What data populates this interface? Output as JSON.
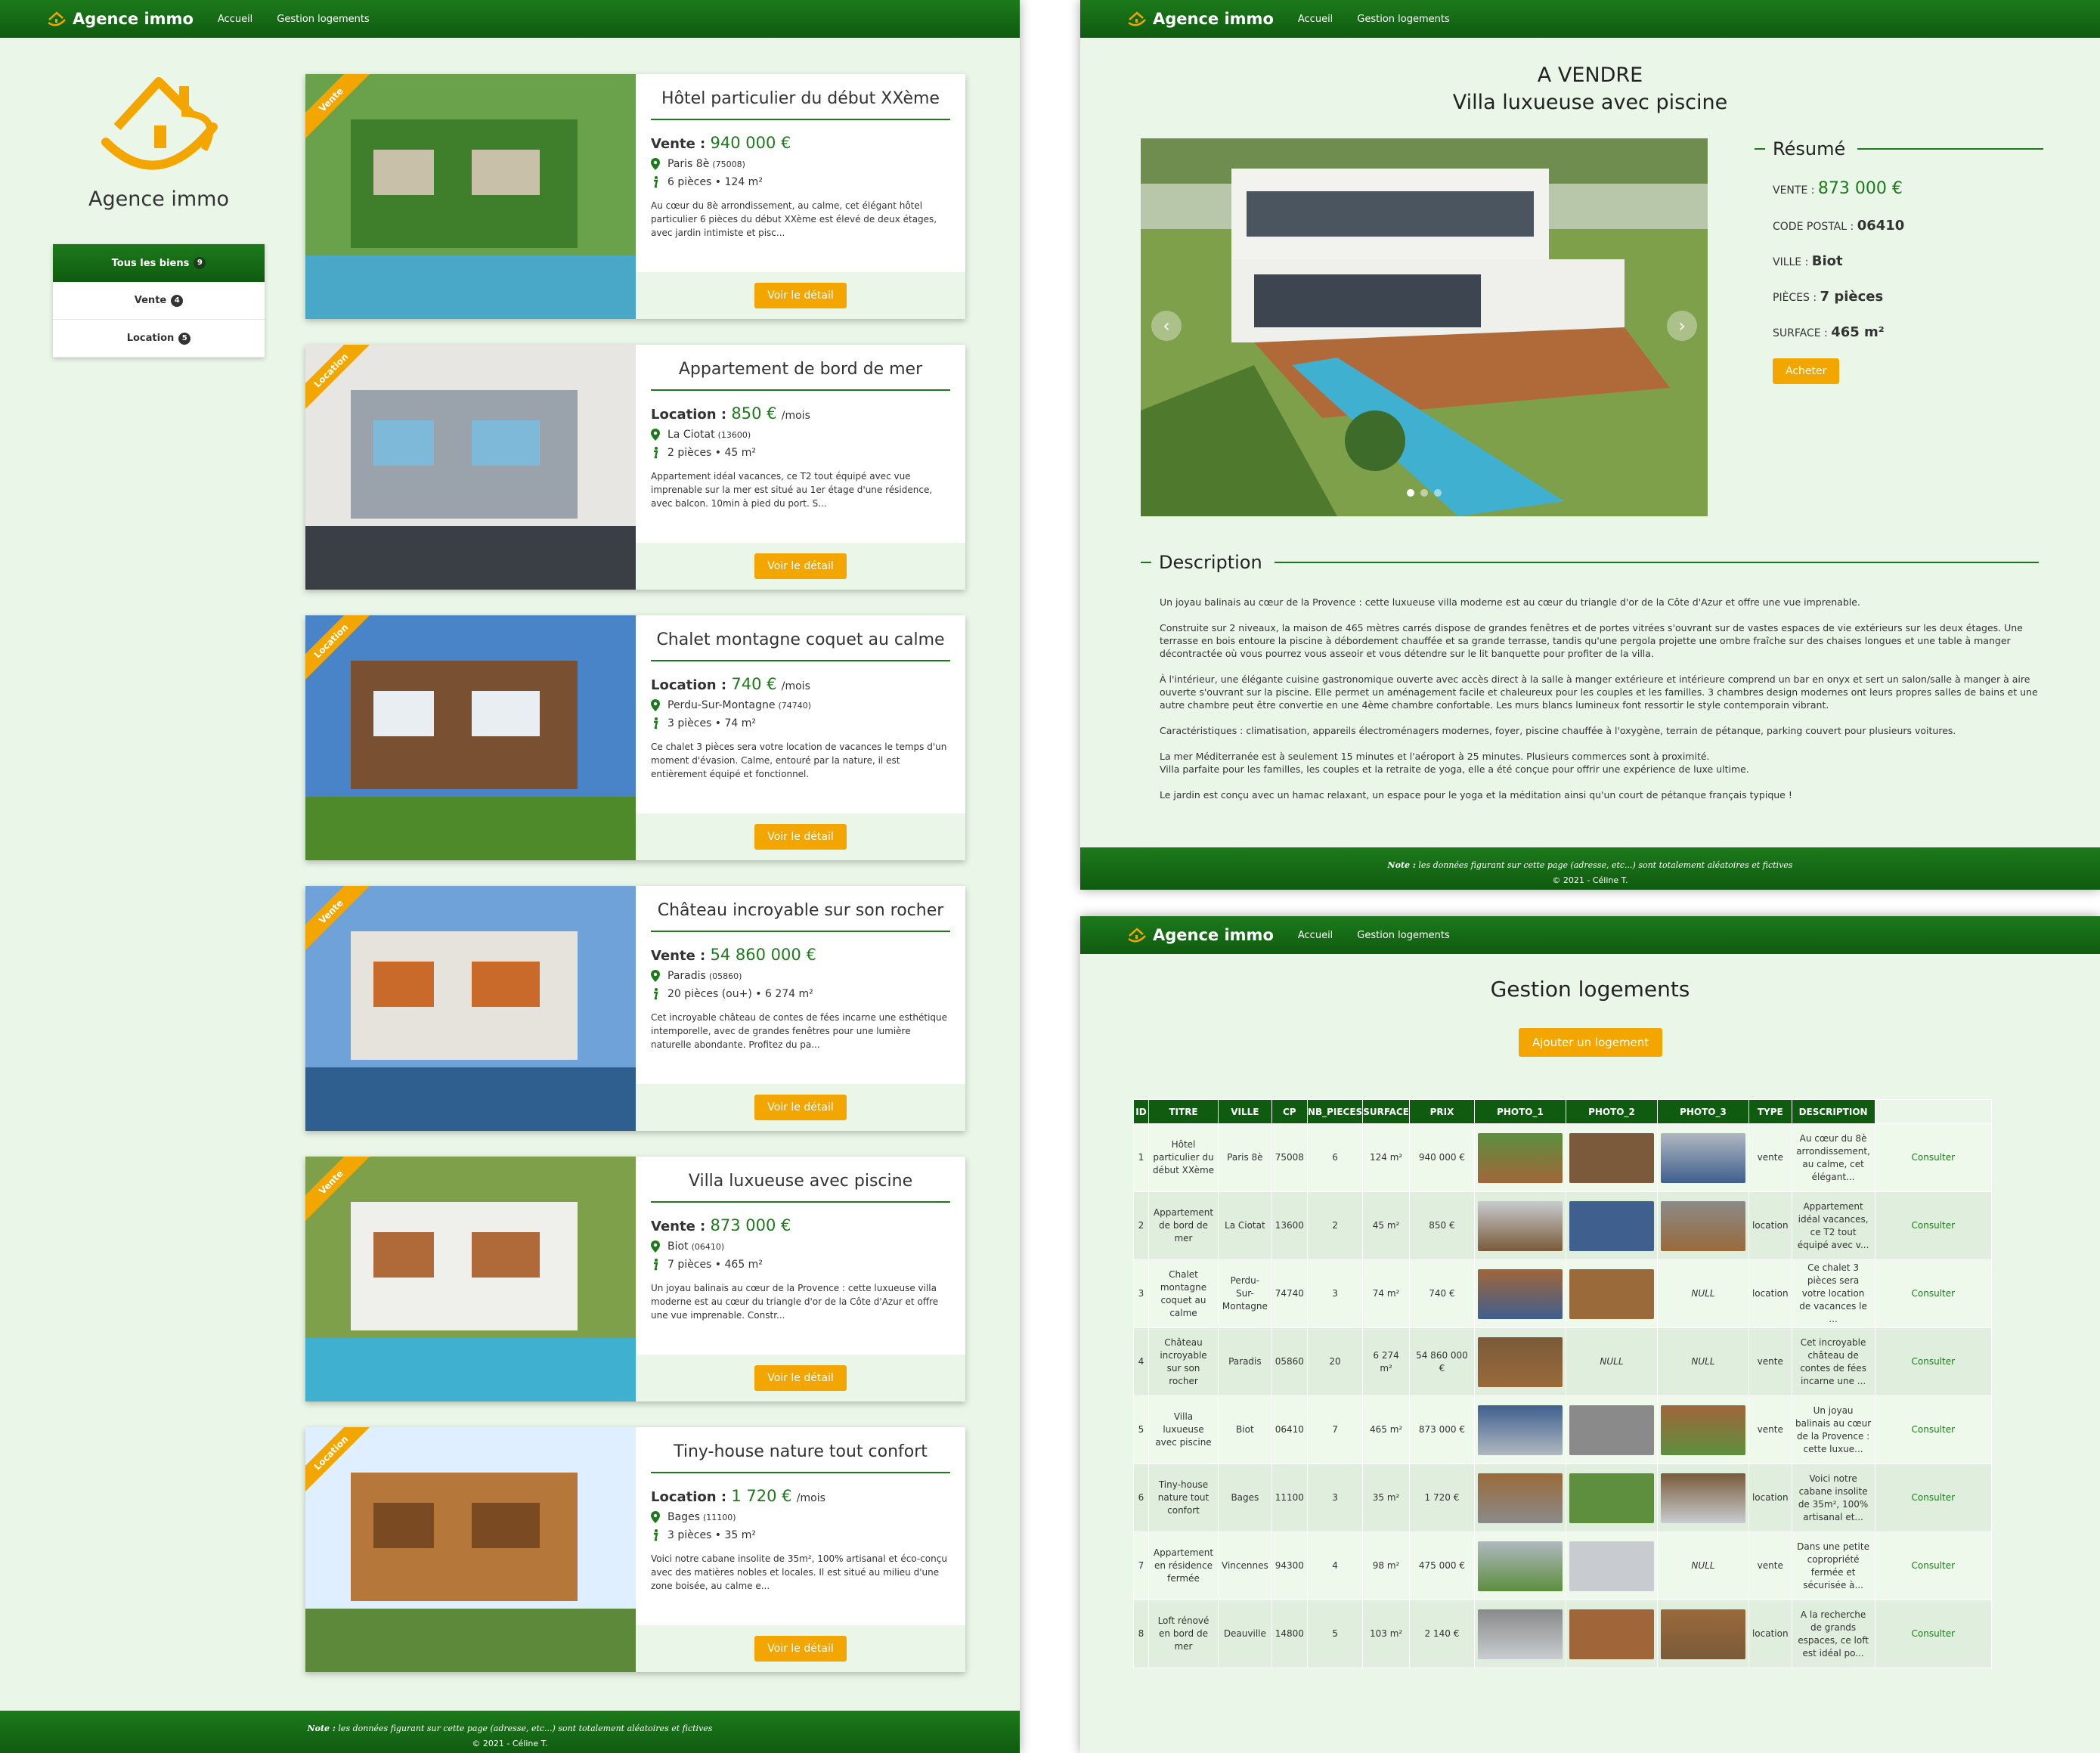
{
  "nav": {
    "brand": "Agence immo",
    "links": [
      "Accueil",
      "Gestion logements"
    ]
  },
  "footer": {
    "note_label": "Note :",
    "note": " les données figurant sur cette page (adresse, etc...) sont totalement aléatoires et fictives",
    "copyright": "© 2021 - Céline T."
  },
  "home": {
    "logo_title": "Agence immo",
    "filters": [
      {
        "label": "Tous les biens",
        "count": "9"
      },
      {
        "label": "Vente",
        "count": "4"
      },
      {
        "label": "Location",
        "count": "5"
      }
    ],
    "listings": [
      {
        "ribbon": "Vente",
        "title": "Hôtel particulier du début XXème",
        "price_label": "Vente :",
        "price": "940 000 €",
        "unit": "",
        "city": "Paris 8è",
        "cp": "(75008)",
        "info": "6 pièces • 124 m²",
        "desc": "Au cœur du 8è arrondissement, au calme, cet élégant hôtel particulier 6 pièces du début XXème est élevé de deux étages, avec jardin intimiste et pisc...",
        "button": "Voir le détail"
      },
      {
        "ribbon": "Location",
        "title": "Appartement de bord de mer",
        "price_label": "Location :",
        "price": "850 €",
        "unit": "/mois",
        "city": "La Ciotat",
        "cp": "(13600)",
        "info": "2 pièces • 45 m²",
        "desc": "Appartement idéal vacances, ce T2 tout équipé avec vue imprenable sur la mer est situé au 1er étage d'une résidence, avec balcon. 10min à pied du port. S...",
        "button": "Voir le détail"
      },
      {
        "ribbon": "Location",
        "title": "Chalet montagne coquet au calme",
        "price_label": "Location :",
        "price": "740 €",
        "unit": "/mois",
        "city": "Perdu-Sur-Montagne",
        "cp": "(74740)",
        "info": "3 pièces • 74 m²",
        "desc": "Ce chalet 3 pièces sera votre location de vacances le temps d'un moment d'évasion. Calme, entouré par la nature, il est entièrement équipé et fonctionnel.",
        "button": "Voir le détail"
      },
      {
        "ribbon": "Vente",
        "title": "Château incroyable sur son rocher",
        "price_label": "Vente :",
        "price": "54 860 000 €",
        "unit": "",
        "city": "Paradis",
        "cp": "(05860)",
        "info": "20 pièces (ou+) • 6 274 m²",
        "desc": "Cet incroyable château de contes de fées incarne une esthétique intemporelle, avec de grandes fenêtres pour une lumière naturelle abondante. Profitez du pa...",
        "button": "Voir le détail"
      },
      {
        "ribbon": "Vente",
        "title": "Villa luxueuse avec piscine",
        "price_label": "Vente :",
        "price": "873 000 €",
        "unit": "",
        "city": "Biot",
        "cp": "(06410)",
        "info": "7 pièces • 465 m²",
        "desc": "Un joyau balinais au cœur de la Provence : cette luxueuse villa moderne est au cœur du triangle d'or de la Côte d'Azur et offre une vue imprenable. Constr...",
        "button": "Voir le détail"
      },
      {
        "ribbon": "Location",
        "title": "Tiny-house nature tout confort",
        "price_label": "Location :",
        "price": "1 720 €",
        "unit": "/mois",
        "city": "Bages",
        "cp": "(11100)",
        "info": "3 pièces • 35 m²",
        "desc": "Voici notre cabane insolite de 35m², 100% artisanal et éco-conçu avec des matières nobles et locales. Il est situé au milieu d'une zone boisée, au calme e...",
        "button": "Voir le détail"
      }
    ]
  },
  "detail": {
    "status": "A VENDRE",
    "title": "Villa luxueuse avec piscine",
    "summary_title": "Résumé",
    "rows": [
      {
        "label": "VENTE :",
        "value": "873 000 €"
      },
      {
        "label": "CODE POSTAL :",
        "value": "06410"
      },
      {
        "label": "VILLE :",
        "value": "Biot"
      },
      {
        "label": "PIÈCES :",
        "value": "7 pièces"
      },
      {
        "label": "SURFACE :",
        "value": "465 m²"
      }
    ],
    "buy": "Acheter",
    "desc_title": "Description",
    "paragraphs": [
      "Un joyau balinais au cœur de la Provence : cette luxueuse villa moderne est au cœur du triangle d'or de la Côte d'Azur et offre une vue imprenable.",
      "Construite sur 2 niveaux, la maison de 465 mètres carrés dispose de grandes fenêtres et de portes vitrées s'ouvrant sur de vastes espaces de vie extérieurs sur les deux étages. Une terrasse en bois entoure la piscine à débordement chauffée et sa grande terrasse, tandis qu'une pergola projette une ombre fraîche sur des chaises longues et une table à manger décontractée où vous pourrez vous asseoir et vous détendre sur le lit banquette pour profiter de la villa.",
      "À l'intérieur, une élégante cuisine gastronomique ouverte avec accès direct à la salle à manger extérieure et intérieure comprend un bar en onyx et sert un salon/salle à manger à aire ouverte s'ouvrant sur la piscine. Elle permet un aménagement facile et chaleureux pour les couples et les familles. 3 chambres design modernes ont leurs propres salles de bains et une autre chambre peut être convertie en une 4ème chambre confortable. Les murs blancs lumineux font ressortir le style contemporain vibrant.",
      "Caractéristiques : climatisation, appareils électroménagers modernes, foyer, piscine chauffée à l'oxygène, terrain de pétanque, parking couvert pour plusieurs voitures.",
      "La mer Méditerranée est à seulement 15 minutes et l'aéroport à 25 minutes. Plusieurs commerces sont à proximité.\nVilla parfaite pour les familles, les couples et la retraite de yoga, elle a été conçue pour offrir une expérience de luxe ultime.",
      "Le jardin est conçu avec un hamac relaxant, un espace pour le yoga et la méditation ainsi qu'un court de pétanque français typique !"
    ]
  },
  "gestion": {
    "title": "Gestion logements",
    "add": "Ajouter un logement",
    "columns": [
      "ID",
      "TITRE",
      "VILLE",
      "CP",
      "NB_PIECES",
      "SURFACE",
      "PRIX",
      "PHOTO_1",
      "PHOTO_2",
      "PHOTO_3",
      "TYPE",
      "DESCRIPTION"
    ],
    "action": "Consulter",
    "null": "NULL",
    "rows": [
      {
        "id": "1",
        "titre": "Hôtel particulier du début XXème",
        "ville": "Paris 8è",
        "cp": "75008",
        "pieces": "6",
        "surface": "124 m²",
        "prix": "940 000 €",
        "photos": [
          true,
          true,
          true
        ],
        "type": "vente",
        "desc": "Au cœur du 8è arrondissement, au calme, cet élégant..."
      },
      {
        "id": "2",
        "titre": "Appartement de bord de mer",
        "ville": "La Ciotat",
        "cp": "13600",
        "pieces": "2",
        "surface": "45 m²",
        "prix": "850 €",
        "photos": [
          true,
          true,
          true
        ],
        "type": "location",
        "desc": "Appartement idéal vacances, ce T2 tout équipé avec v..."
      },
      {
        "id": "3",
        "titre": "Chalet montagne coquet au calme",
        "ville": "Perdu-Sur-Montagne",
        "cp": "74740",
        "pieces": "3",
        "surface": "74 m²",
        "prix": "740 €",
        "photos": [
          true,
          true,
          false
        ],
        "type": "location",
        "desc": "Ce chalet 3 pièces sera votre location de vacances le ..."
      },
      {
        "id": "4",
        "titre": "Château incroyable sur son rocher",
        "ville": "Paradis",
        "cp": "05860",
        "pieces": "20",
        "surface": "6 274 m²",
        "prix": "54 860 000 €",
        "photos": [
          true,
          false,
          false
        ],
        "type": "vente",
        "desc": "Cet incroyable château de contes de fées incarne une ..."
      },
      {
        "id": "5",
        "titre": "Villa luxueuse avec piscine",
        "ville": "Biot",
        "cp": "06410",
        "pieces": "7",
        "surface": "465 m²",
        "prix": "873 000 €",
        "photos": [
          true,
          true,
          true
        ],
        "type": "vente",
        "desc": "Un joyau balinais au cœur de la Provence : cette luxue..."
      },
      {
        "id": "6",
        "titre": "Tiny-house nature tout confort",
        "ville": "Bages",
        "cp": "11100",
        "pieces": "3",
        "surface": "35 m²",
        "prix": "1 720 €",
        "photos": [
          true,
          true,
          true
        ],
        "type": "location",
        "desc": "Voici notre cabane insolite de 35m², 100% artisanal et..."
      },
      {
        "id": "7",
        "titre": "Appartement en résidence fermée",
        "ville": "Vincennes",
        "cp": "94300",
        "pieces": "4",
        "surface": "98 m²",
        "prix": "475 000 €",
        "photos": [
          true,
          true,
          false
        ],
        "type": "vente",
        "desc": "Dans une petite copropriété fermée et sécurisée à..."
      },
      {
        "id": "8",
        "titre": "Loft rénové en bord de mer",
        "ville": "Deauville",
        "cp": "14800",
        "pieces": "5",
        "surface": "103 m²",
        "prix": "2 140 €",
        "photos": [
          true,
          true,
          true
        ],
        "type": "location",
        "desc": "A la recherche de grands espaces, ce loft est idéal po..."
      }
    ]
  }
}
